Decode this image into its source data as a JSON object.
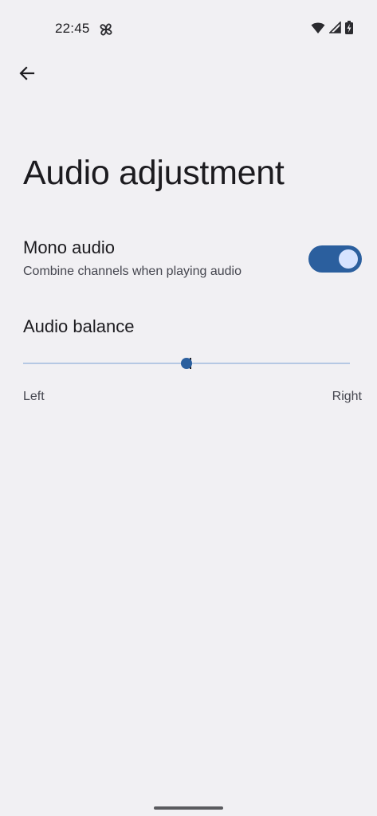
{
  "status_bar": {
    "time": "22:45",
    "icons": [
      "pinwheel-icon",
      "wifi-icon",
      "signal-icon",
      "battery-charging-icon"
    ]
  },
  "toolbar": {
    "back_icon": "arrow-back-icon"
  },
  "page": {
    "title": "Audio adjustment"
  },
  "mono_audio": {
    "title": "Mono audio",
    "summary": "Combine channels when playing audio",
    "enabled": true
  },
  "audio_balance": {
    "title": "Audio balance",
    "value_fraction": 0.5,
    "left_label": "Left",
    "right_label": "Right"
  },
  "colors": {
    "background": "#f1f0f3",
    "accent": "#2b5f9e",
    "switch_thumb": "#d6e3ff",
    "track_inactive": "#b5c8e3",
    "text_primary": "#1c1b1f",
    "text_secondary": "#45464f"
  }
}
